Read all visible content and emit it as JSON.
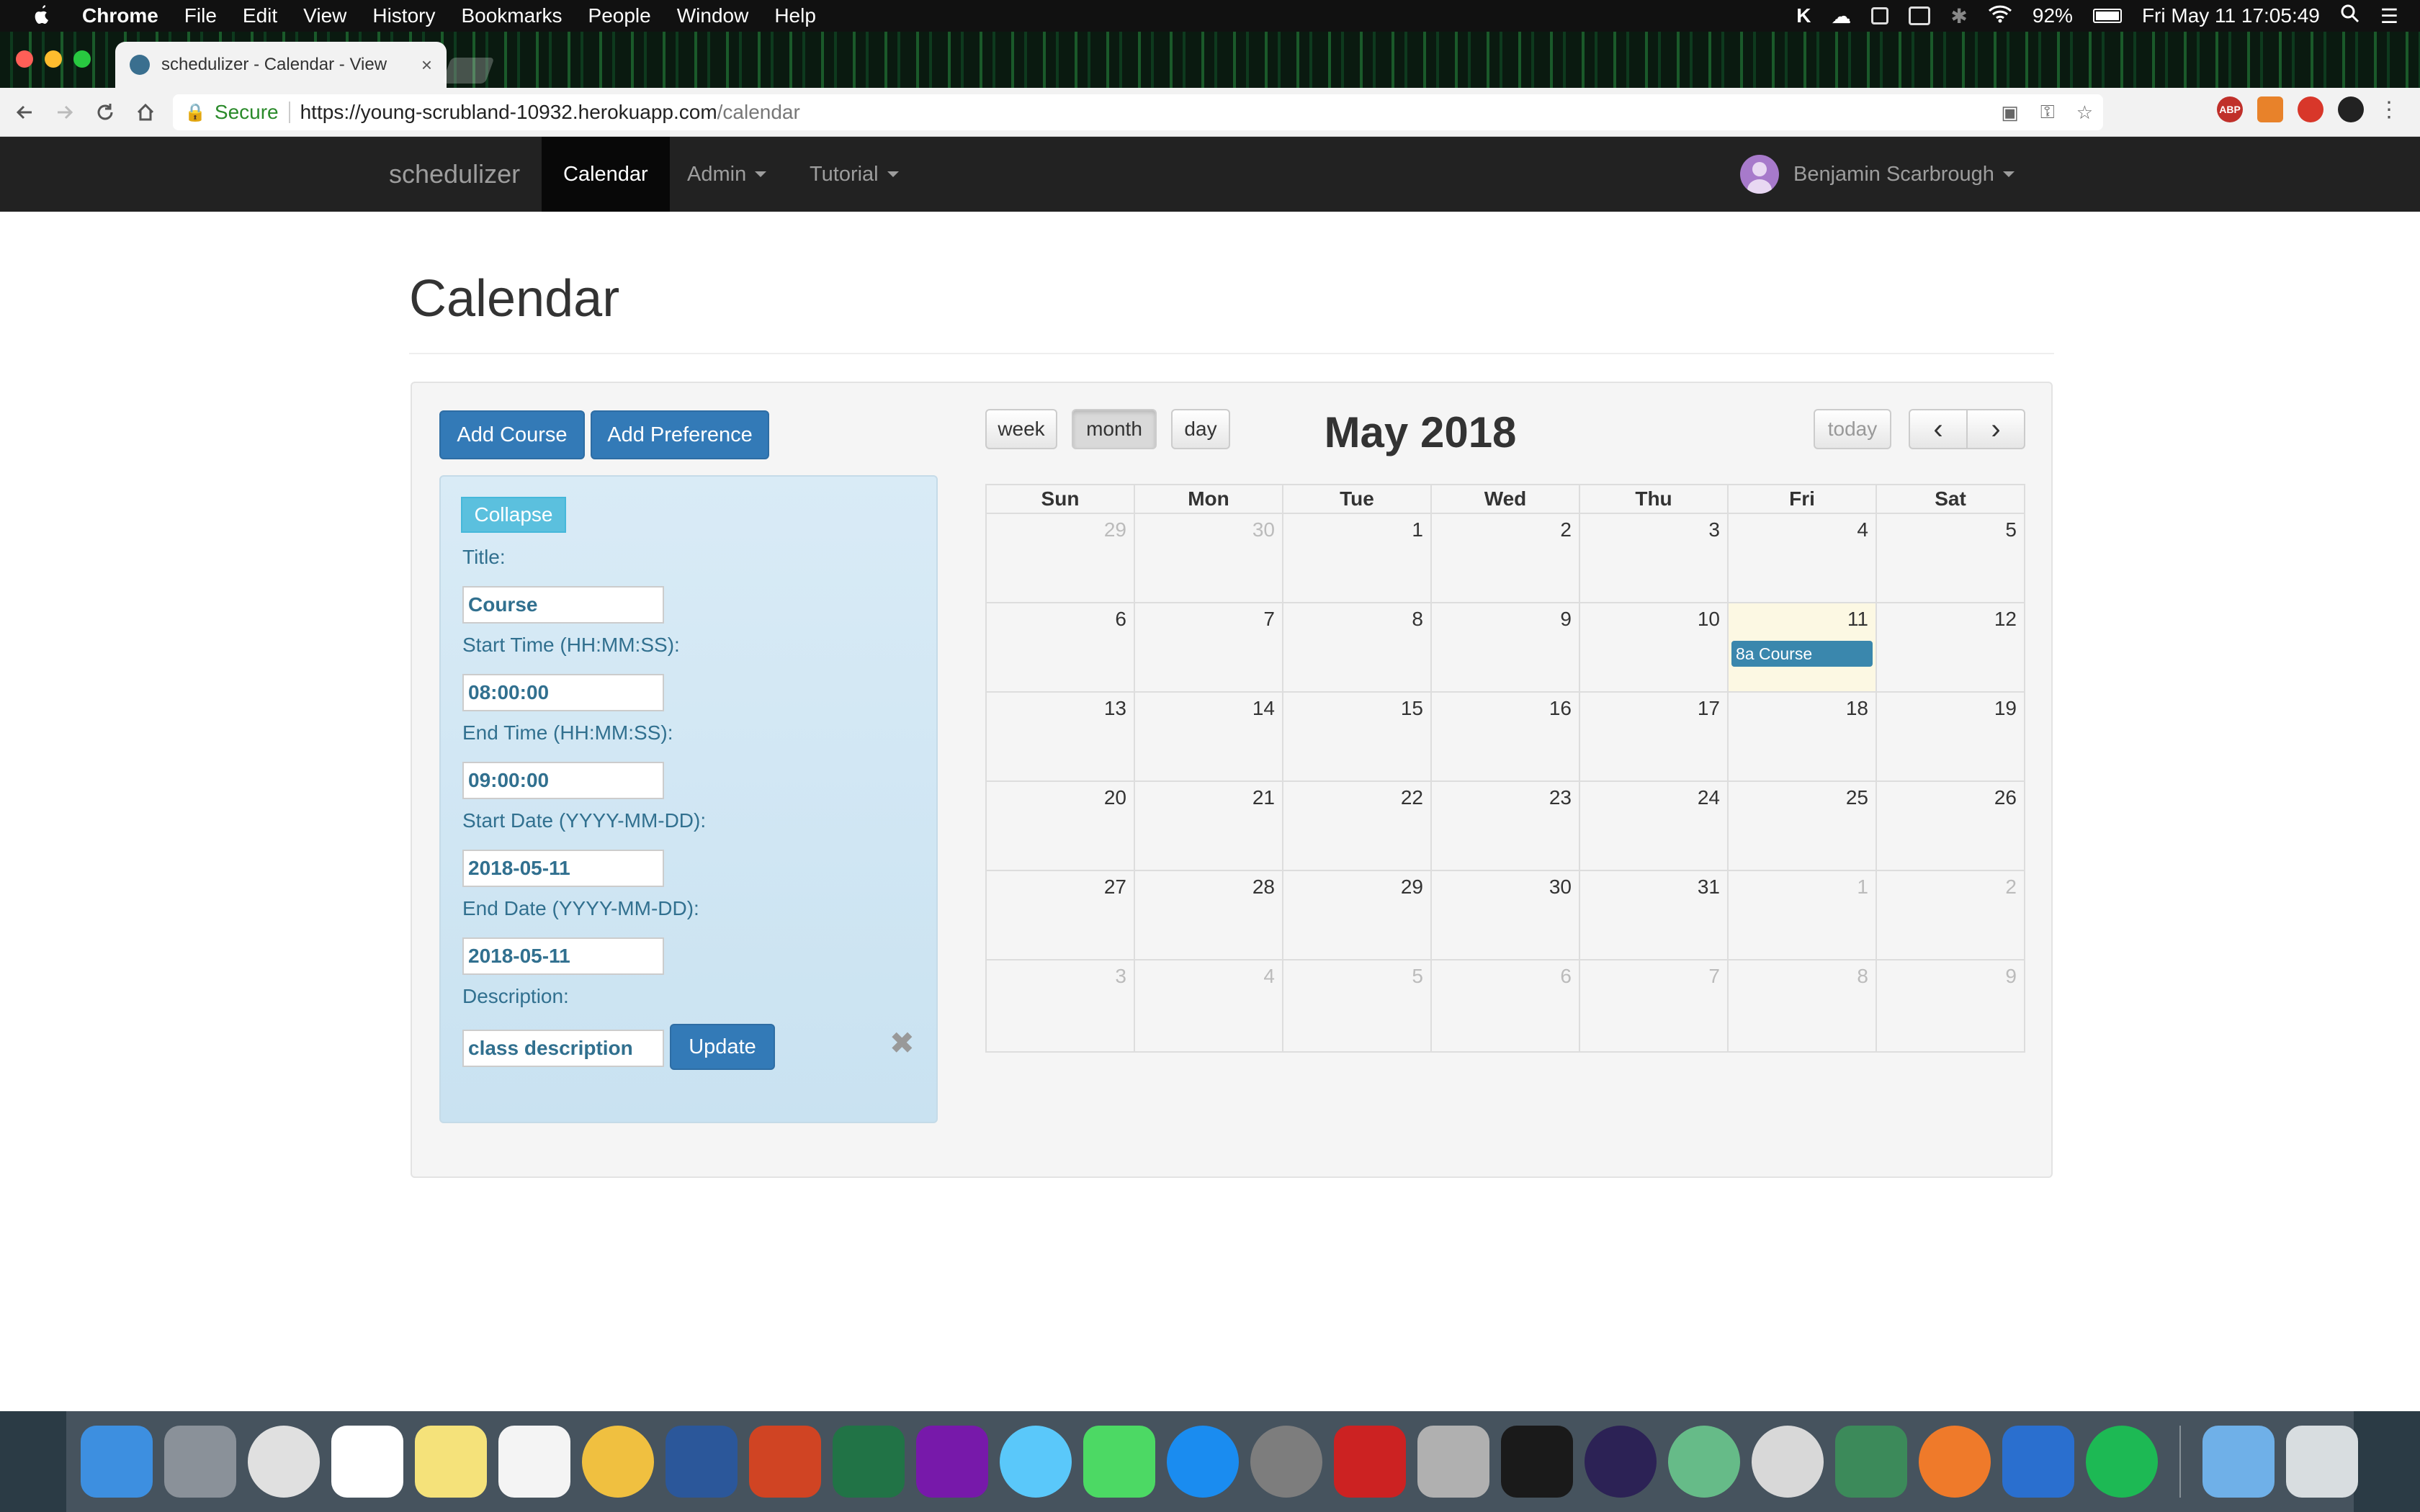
{
  "menubar": {
    "app_name": "Chrome",
    "menus": [
      "File",
      "Edit",
      "View",
      "History",
      "Bookmarks",
      "People",
      "Window",
      "Help"
    ],
    "battery": "92%",
    "clock": "Fri May 11  17:05:49"
  },
  "browser": {
    "tab_title": "schedulizer - Calendar - View",
    "tab_close": "×",
    "secure_label": "Secure",
    "url_host": "https://young-scrubland-10932.herokuapp.com",
    "url_path": "/calendar",
    "extensions": [
      "ABP"
    ]
  },
  "navbar": {
    "brand": "schedulizer",
    "links": [
      "Calendar",
      "Admin",
      "Tutorial"
    ],
    "active": "Calendar",
    "user_name": "Benjamin Scarbrough"
  },
  "page": {
    "title": "Calendar",
    "add_course_label": "Add Course",
    "add_preference_label": "Add Preference"
  },
  "form": {
    "collapse_label": "Collapse",
    "title_label": "Title:",
    "title_value": "Course",
    "start_time_label": "Start Time (HH:MM:SS):",
    "start_time_value": "08:00:00",
    "end_time_label": "End Time (HH:MM:SS):",
    "end_time_value": "09:00:00",
    "start_date_label": "Start Date (YYYY-MM-DD):",
    "start_date_value": "2018-05-11",
    "end_date_label": "End Date (YYYY-MM-DD):",
    "end_date_value": "2018-05-11",
    "description_label": "Description:",
    "description_value": "class description",
    "update_label": "Update",
    "close_glyph": "✖"
  },
  "calendar": {
    "view_buttons": [
      "week",
      "month",
      "day"
    ],
    "active_view": "month",
    "title": "May 2018",
    "today_label": "today",
    "prev_glyph": "‹",
    "next_glyph": "›",
    "days_of_week": [
      "Sun",
      "Mon",
      "Tue",
      "Wed",
      "Thu",
      "Fri",
      "Sat"
    ],
    "weeks": [
      [
        {
          "d": "29",
          "other": true
        },
        {
          "d": "30",
          "other": true
        },
        {
          "d": "1"
        },
        {
          "d": "2"
        },
        {
          "d": "3"
        },
        {
          "d": "4"
        },
        {
          "d": "5"
        }
      ],
      [
        {
          "d": "6"
        },
        {
          "d": "7"
        },
        {
          "d": "8"
        },
        {
          "d": "9"
        },
        {
          "d": "10"
        },
        {
          "d": "11",
          "today": true,
          "event": "8a Course"
        },
        {
          "d": "12"
        }
      ],
      [
        {
          "d": "13"
        },
        {
          "d": "14"
        },
        {
          "d": "15"
        },
        {
          "d": "16"
        },
        {
          "d": "17"
        },
        {
          "d": "18"
        },
        {
          "d": "19"
        }
      ],
      [
        {
          "d": "20"
        },
        {
          "d": "21"
        },
        {
          "d": "22"
        },
        {
          "d": "23"
        },
        {
          "d": "24"
        },
        {
          "d": "25"
        },
        {
          "d": "26"
        }
      ],
      [
        {
          "d": "27"
        },
        {
          "d": "28"
        },
        {
          "d": "29"
        },
        {
          "d": "30"
        },
        {
          "d": "31"
        },
        {
          "d": "1",
          "other": true
        },
        {
          "d": "2",
          "other": true
        }
      ],
      [
        {
          "d": "3",
          "other": true
        },
        {
          "d": "4",
          "other": true
        },
        {
          "d": "5",
          "other": true
        },
        {
          "d": "6",
          "other": true
        },
        {
          "d": "7",
          "other": true
        },
        {
          "d": "8",
          "other": true
        },
        {
          "d": "9",
          "other": true
        }
      ]
    ]
  },
  "dock": {
    "apps": [
      {
        "name": "finder",
        "color": "#3d8fe0"
      },
      {
        "name": "launchpad",
        "color": "#8a9199"
      },
      {
        "name": "chrome",
        "color": "#e0e0e0"
      },
      {
        "name": "calendar",
        "color": "#ffffff"
      },
      {
        "name": "notes",
        "color": "#f5e27a"
      },
      {
        "name": "reminders",
        "color": "#f4f4f4"
      },
      {
        "name": "photos",
        "color": "#f0c040"
      },
      {
        "name": "word",
        "color": "#2b579a"
      },
      {
        "name": "powerpoint",
        "color": "#d04423"
      },
      {
        "name": "excel",
        "color": "#217346"
      },
      {
        "name": "onenote",
        "color": "#7719aa"
      },
      {
        "name": "messages",
        "color": "#5ac8fa"
      },
      {
        "name": "facetime",
        "color": "#4cd964"
      },
      {
        "name": "app-store",
        "color": "#1a8cf0"
      },
      {
        "name": "system-preferences",
        "color": "#7d7d7d"
      },
      {
        "name": "vim",
        "color": "#cc2222"
      },
      {
        "name": "calculator",
        "color": "#b0b0b0"
      },
      {
        "name": "terminal",
        "color": "#1a1a1a"
      },
      {
        "name": "eclipse",
        "color": "#2c2255"
      },
      {
        "name": "atom",
        "color": "#66bb88"
      },
      {
        "name": "owl",
        "color": "#d8d8d8"
      },
      {
        "name": "sourcetree",
        "color": "#3c8a5a"
      },
      {
        "name": "postman",
        "color": "#ef7a2a"
      },
      {
        "name": "xcode",
        "color": "#2a6fcf"
      },
      {
        "name": "spotify",
        "color": "#1db954"
      },
      {
        "name": "downloads",
        "color": "#6fb0e8"
      },
      {
        "name": "trash",
        "color": "#d8dde0"
      }
    ]
  }
}
